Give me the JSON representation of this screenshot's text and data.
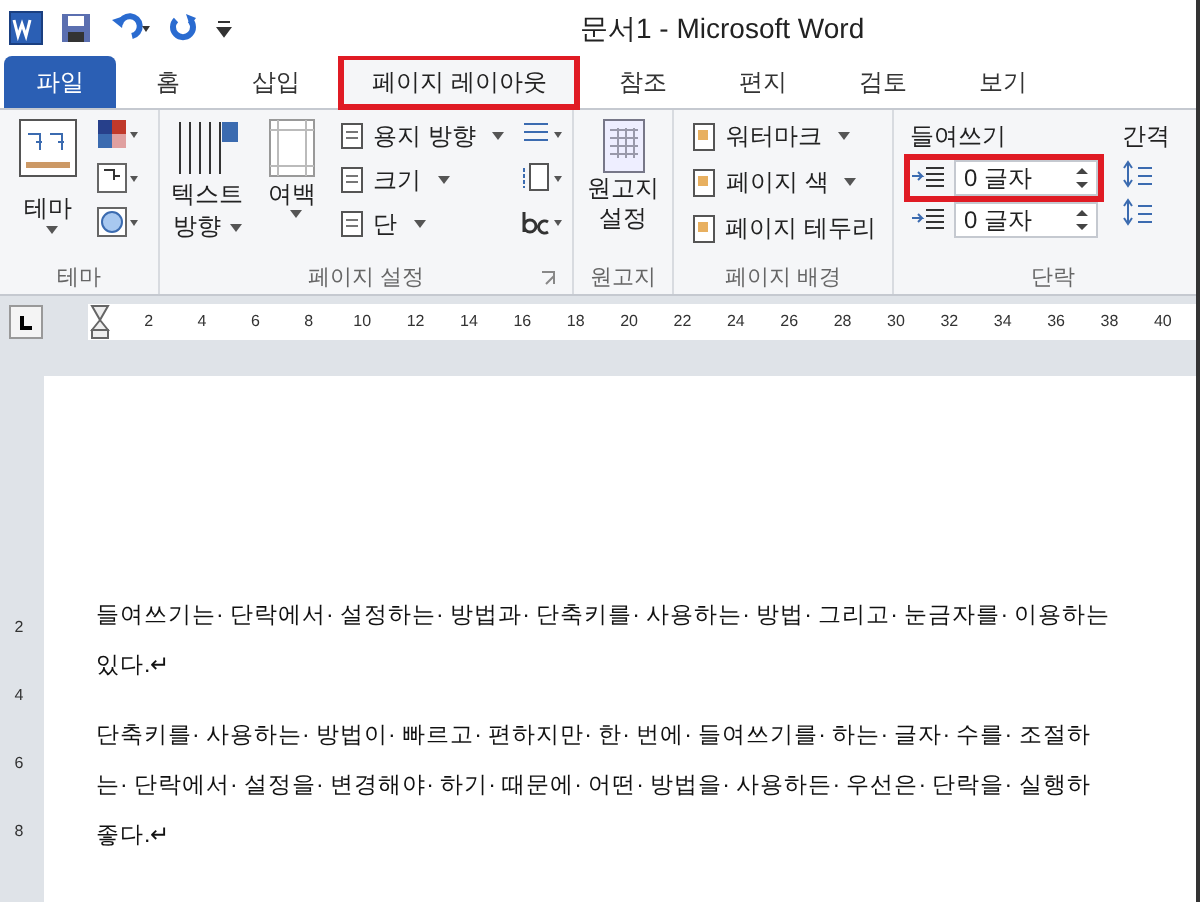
{
  "window": {
    "title": "문서1  -  Microsoft Word"
  },
  "tabs": [
    {
      "label": "파일",
      "kind": "file",
      "selected": false,
      "highlighted": false
    },
    {
      "label": "홈",
      "kind": "tab",
      "selected": false,
      "highlighted": false
    },
    {
      "label": "삽입",
      "kind": "tab",
      "selected": false,
      "highlighted": false
    },
    {
      "label": "페이지 레이아웃",
      "kind": "tab",
      "selected": true,
      "highlighted": true
    },
    {
      "label": "참조",
      "kind": "tab",
      "selected": false,
      "highlighted": false
    },
    {
      "label": "편지",
      "kind": "tab",
      "selected": false,
      "highlighted": false
    },
    {
      "label": "검토",
      "kind": "tab",
      "selected": false,
      "highlighted": false
    },
    {
      "label": "보기",
      "kind": "tab",
      "selected": false,
      "highlighted": false
    }
  ],
  "ribbon": {
    "theme": {
      "button": "테마",
      "label": "테마"
    },
    "page_setup": {
      "text_direction": [
        "텍스트",
        "방향"
      ],
      "margins": "여백",
      "orientation": "용지 방향",
      "size": "크기",
      "columns": "단",
      "label": "페이지 설정"
    },
    "manuscript": {
      "button": [
        "원고지",
        "설정"
      ],
      "label": "원고지"
    },
    "page_background": {
      "watermark": "워터마크",
      "page_color": "페이지 색",
      "page_borders": "페이지 테두리",
      "label": "페이지 배경"
    },
    "paragraph": {
      "indent_label": "들여쓰기",
      "indent_left": {
        "value": "0 글자",
        "highlighted": true
      },
      "indent_right": {
        "value": "0 글자",
        "highlighted": false
      },
      "spacing_label": "간격",
      "label": "단락"
    }
  },
  "ruler": [
    "2",
    "4",
    "6",
    "8",
    "10",
    "12",
    "14",
    "16",
    "18",
    "20",
    "22",
    "24",
    "26",
    "28",
    "30",
    "32",
    "34",
    "36",
    "38",
    "40"
  ],
  "vertical_ruler": [
    "2",
    "4",
    "6",
    "8"
  ],
  "document": {
    "paragraphs": [
      {
        "lines": [
          "들여쓰기는· 단락에서· 설정하는· 방법과· 단축키를· 사용하는· 방법· 그리고· 눈금자를· 이용하는",
          "있다.↵"
        ]
      },
      {
        "lines": [
          "단축키를· 사용하는· 방법이· 빠르고· 편하지만· 한· 번에· 들여쓰기를· 하는· 글자· 수를· 조절하",
          "는· 단락에서· 설정을· 변경해야· 하기· 때문에· 어떤· 방법을· 사용하든· 우선은· 단락을· 실행하",
          "좋다.↵"
        ]
      }
    ]
  }
}
